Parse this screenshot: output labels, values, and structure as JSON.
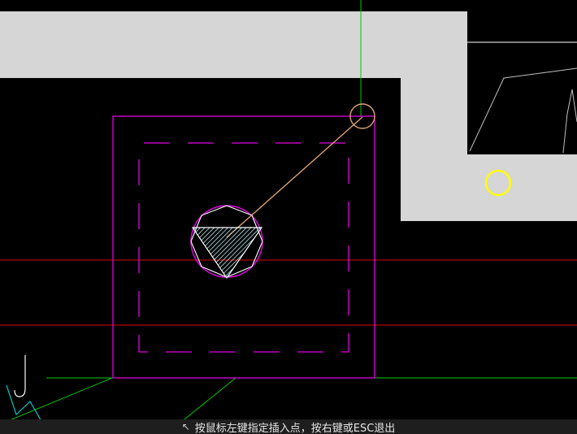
{
  "command_prompt": {
    "arrow_glyph": "↖",
    "text": "按鼠标左键指定插入点，按右键或ESC退出"
  },
  "colors": {
    "background": "#000000",
    "wall": "#d6d6d6",
    "column_outline": "#e000e0",
    "axis_red": "#e00000",
    "axis_green": "#00c800",
    "leader": "#d9a070",
    "pile_hatch": "#b8eaf0",
    "pile_outline": "#ffffff",
    "cursor_ring": "#ffff00",
    "cyan_line": "#00c8c8"
  },
  "icons": {
    "pile": "triangle-pile-icon",
    "cursor": "pickbox-cursor-icon",
    "snap": "snap-marker-icon"
  }
}
